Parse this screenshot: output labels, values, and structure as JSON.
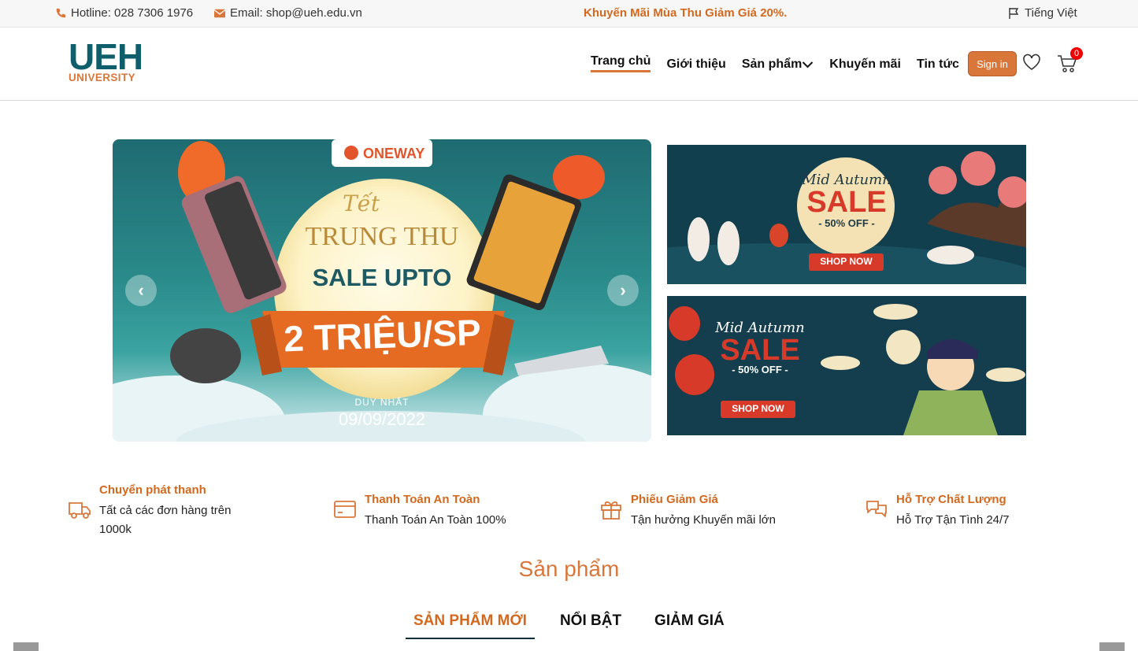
{
  "topbar": {
    "hotline": "Hotline: 028 7306 1976",
    "email": "Email: shop@ueh.edu.vn",
    "promo": "Khuyến Mãi Mùa Thu Giảm Giá 20%.",
    "language": "Tiếng Việt"
  },
  "logo": {
    "line1": "UEH",
    "line2": "UNIVERSITY"
  },
  "nav": {
    "items": [
      "Trang chủ",
      "Giới thiệu",
      "Sản phẩm",
      "Khuyến mãi",
      "Tin tức"
    ],
    "signin": "Sign in",
    "cart_count": "0"
  },
  "main_banner": {
    "brand": "ONEWAY",
    "tet": "Tết",
    "title": "TRUNG THU",
    "sale": "SALE UPTO",
    "amount": "2 TRIỆU/SP",
    "only": "DUY NHẤT",
    "date": "09/09/2022"
  },
  "side_banner_1": {
    "title": "Mid Autumn",
    "sale": "SALE",
    "off": "- 50% OFF -",
    "cta": "SHOP NOW"
  },
  "side_banner_2": {
    "title": "Mid Autumn",
    "sale": "SALE",
    "off": "- 50% OFF -",
    "cta": "SHOP NOW"
  },
  "features": [
    {
      "title": "Chuyển phát thanh",
      "desc": "Tất cả các đơn hàng trên 1000k",
      "icon": "truck-icon"
    },
    {
      "title": "Thanh Toán An Toàn",
      "desc": "Thanh Toán An Toàn 100%",
      "icon": "credit-card-icon"
    },
    {
      "title": "Phiếu Giảm Giá",
      "desc": "Tận hưởng Khuyến mãi lớn",
      "icon": "gift-icon"
    },
    {
      "title": "Hỗ Trợ Chất Lượng",
      "desc": "Hỗ Trợ Tận Tình 24/7",
      "icon": "chat-icon"
    }
  ],
  "products": {
    "title": "Sản phẩm",
    "tabs": [
      "SẢN PHẨM MỚI",
      "NỔI BẬT",
      "GIẢM GIÁ"
    ]
  },
  "colors": {
    "accent": "#d9773a",
    "brand_teal": "#0e5f6b",
    "badge": "#ee0000"
  }
}
